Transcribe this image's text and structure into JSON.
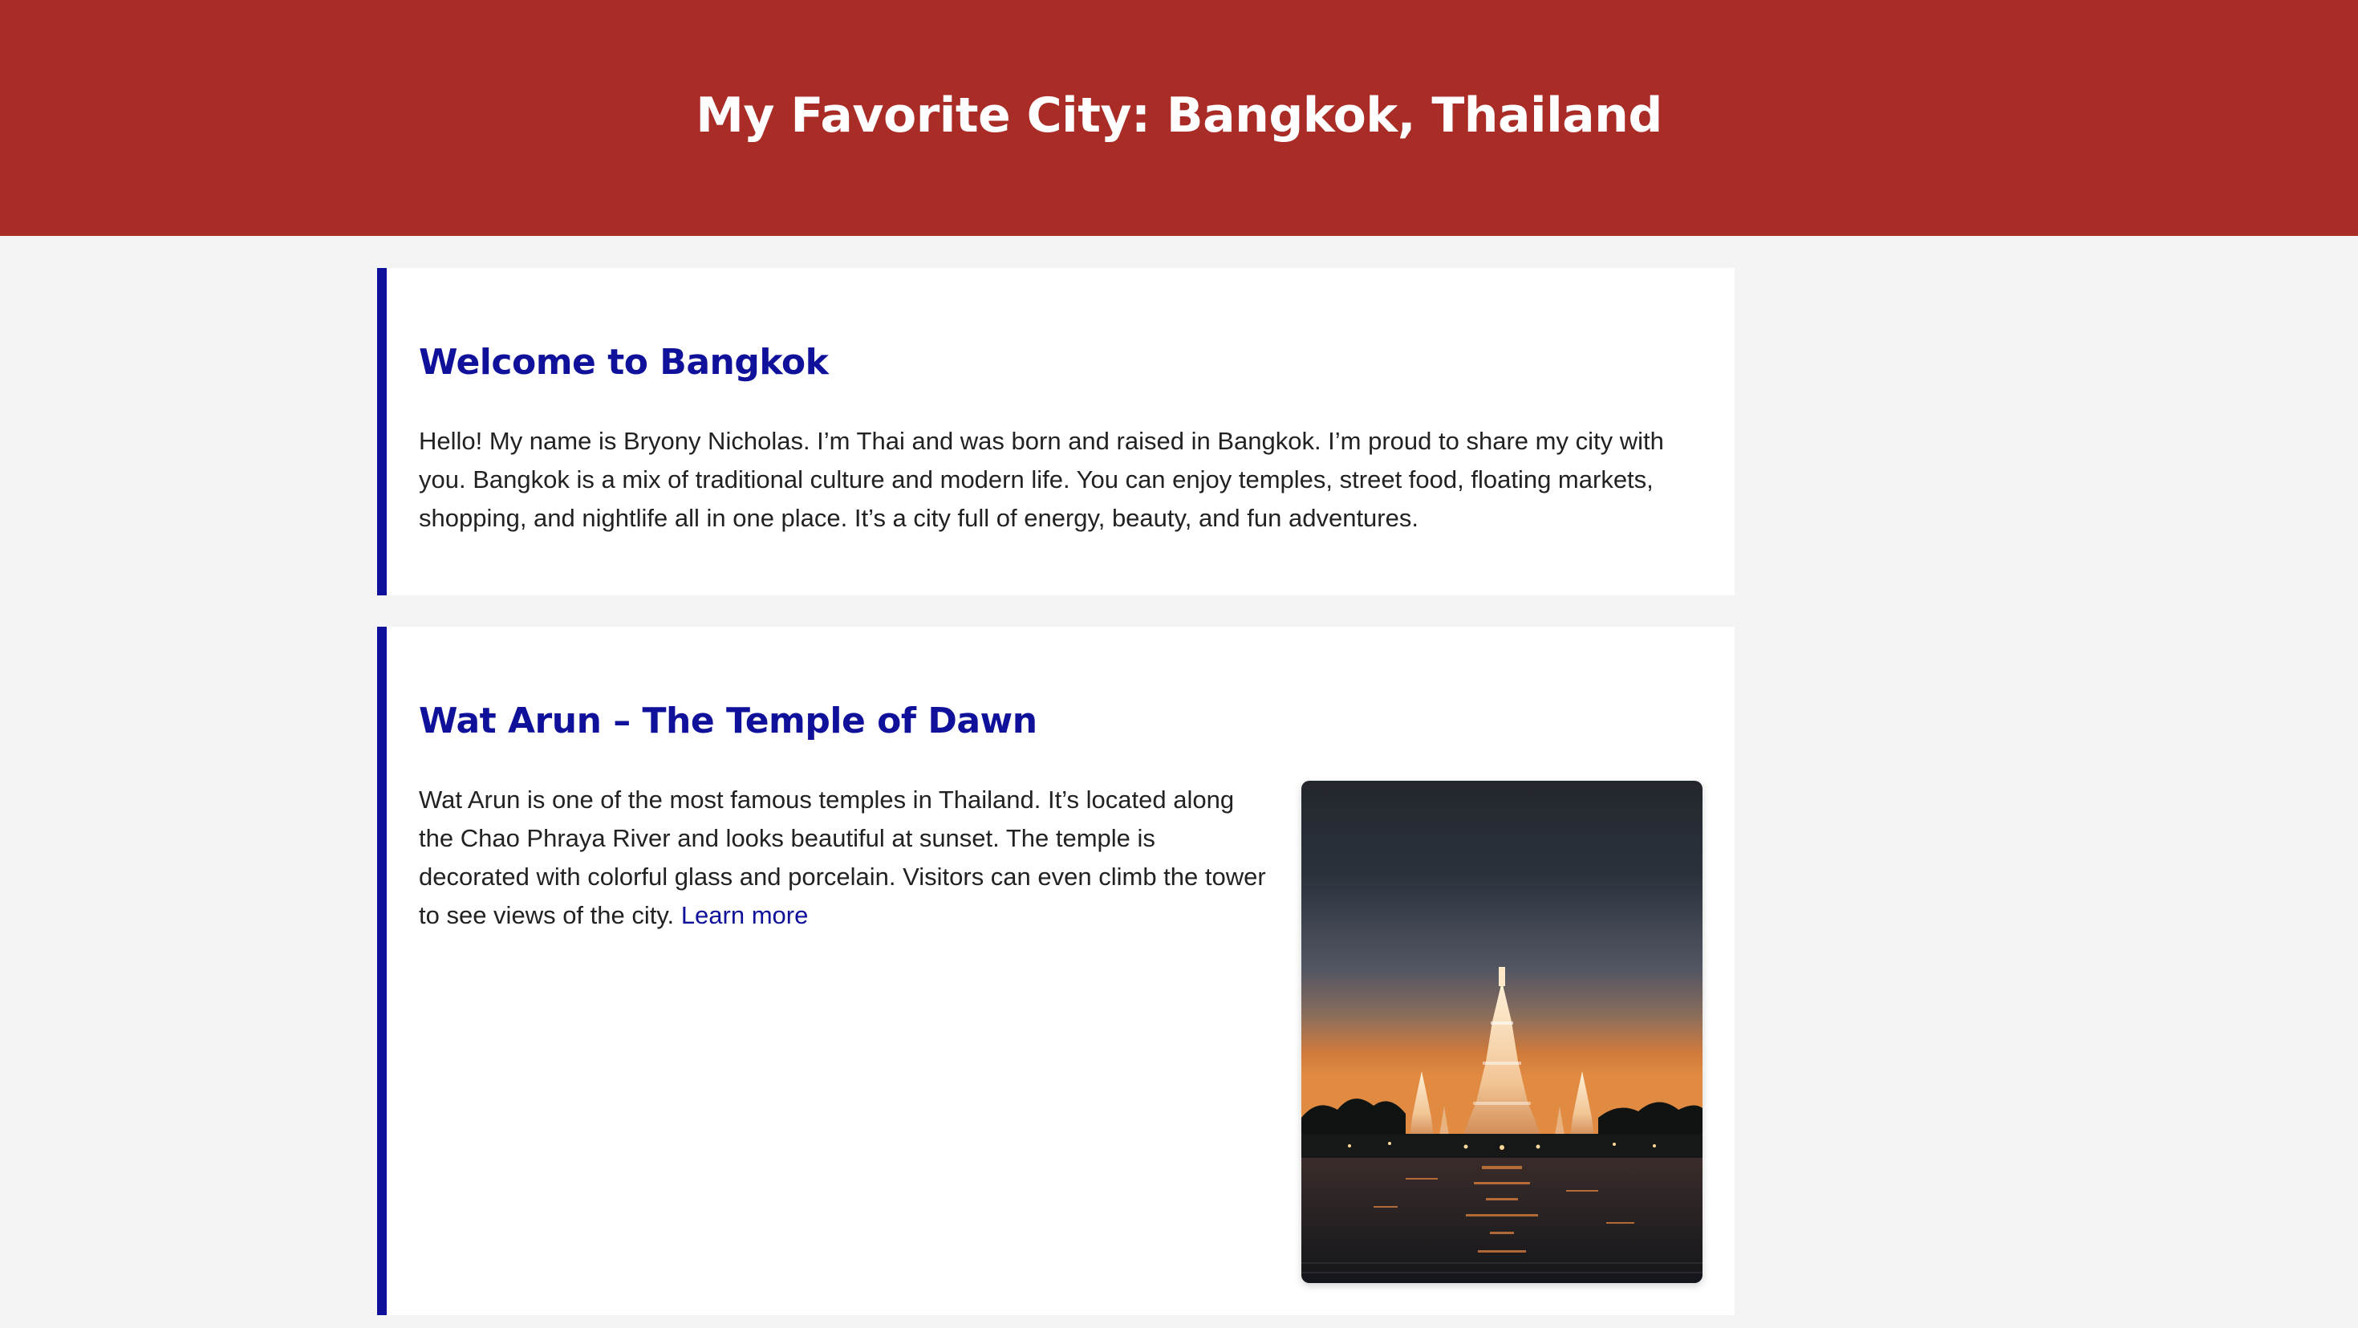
{
  "header": {
    "title": "My Favorite City: Bangkok, Thailand"
  },
  "sections": [
    {
      "heading": "Welcome to Bangkok",
      "body": "Hello! My name is Bryony Nicholas. I’m Thai and was born and raised in Bangkok. I’m proud to share my city with you. Bangkok is a mix of traditional culture and modern life. You can enjoy temples, street food, floating markets, shopping, and nightlife all in one place. It’s a city full of energy, beauty, and fun adventures."
    },
    {
      "heading": "Wat Arun – The Temple of Dawn",
      "body": "Wat Arun is one of the most famous temples in Thailand. It’s located along the Chao Phraya River and looks beautiful at sunset. The temple is decorated with colorful glass and porcelain. Visitors can even climb the tower to see views of the city.",
      "link_label": "Learn more",
      "image": {
        "subject": "Wat Arun temple at sunset over the river"
      }
    }
  ],
  "colors": {
    "header_bg": "#aa2c27",
    "accent": "#10119a",
    "page_bg": "#f4f4f4",
    "body_text": "#222222"
  }
}
